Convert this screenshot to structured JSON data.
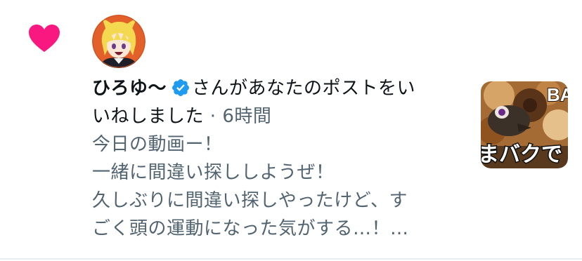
{
  "notification": {
    "icon": "heart-icon",
    "heart_color": "#f91880",
    "verified_icon": "verified-badge-icon",
    "verified_color": "#1d9bf0",
    "username": "ひろゆ〜",
    "action_text_1": "さんがあなたのポストをい",
    "action_text_2": "いねしました",
    "separator": " · ",
    "time": "6時間",
    "post_lines": [
      "今日の動画ー！",
      "一緒に間違い探ししようぜ！",
      "久しぶりに間違い探しやったけど、す",
      "ごく頭の運動になった気がする…！…"
    ],
    "thumbnail": {
      "text_top": "BA",
      "text_bottom": "まバクで"
    }
  }
}
